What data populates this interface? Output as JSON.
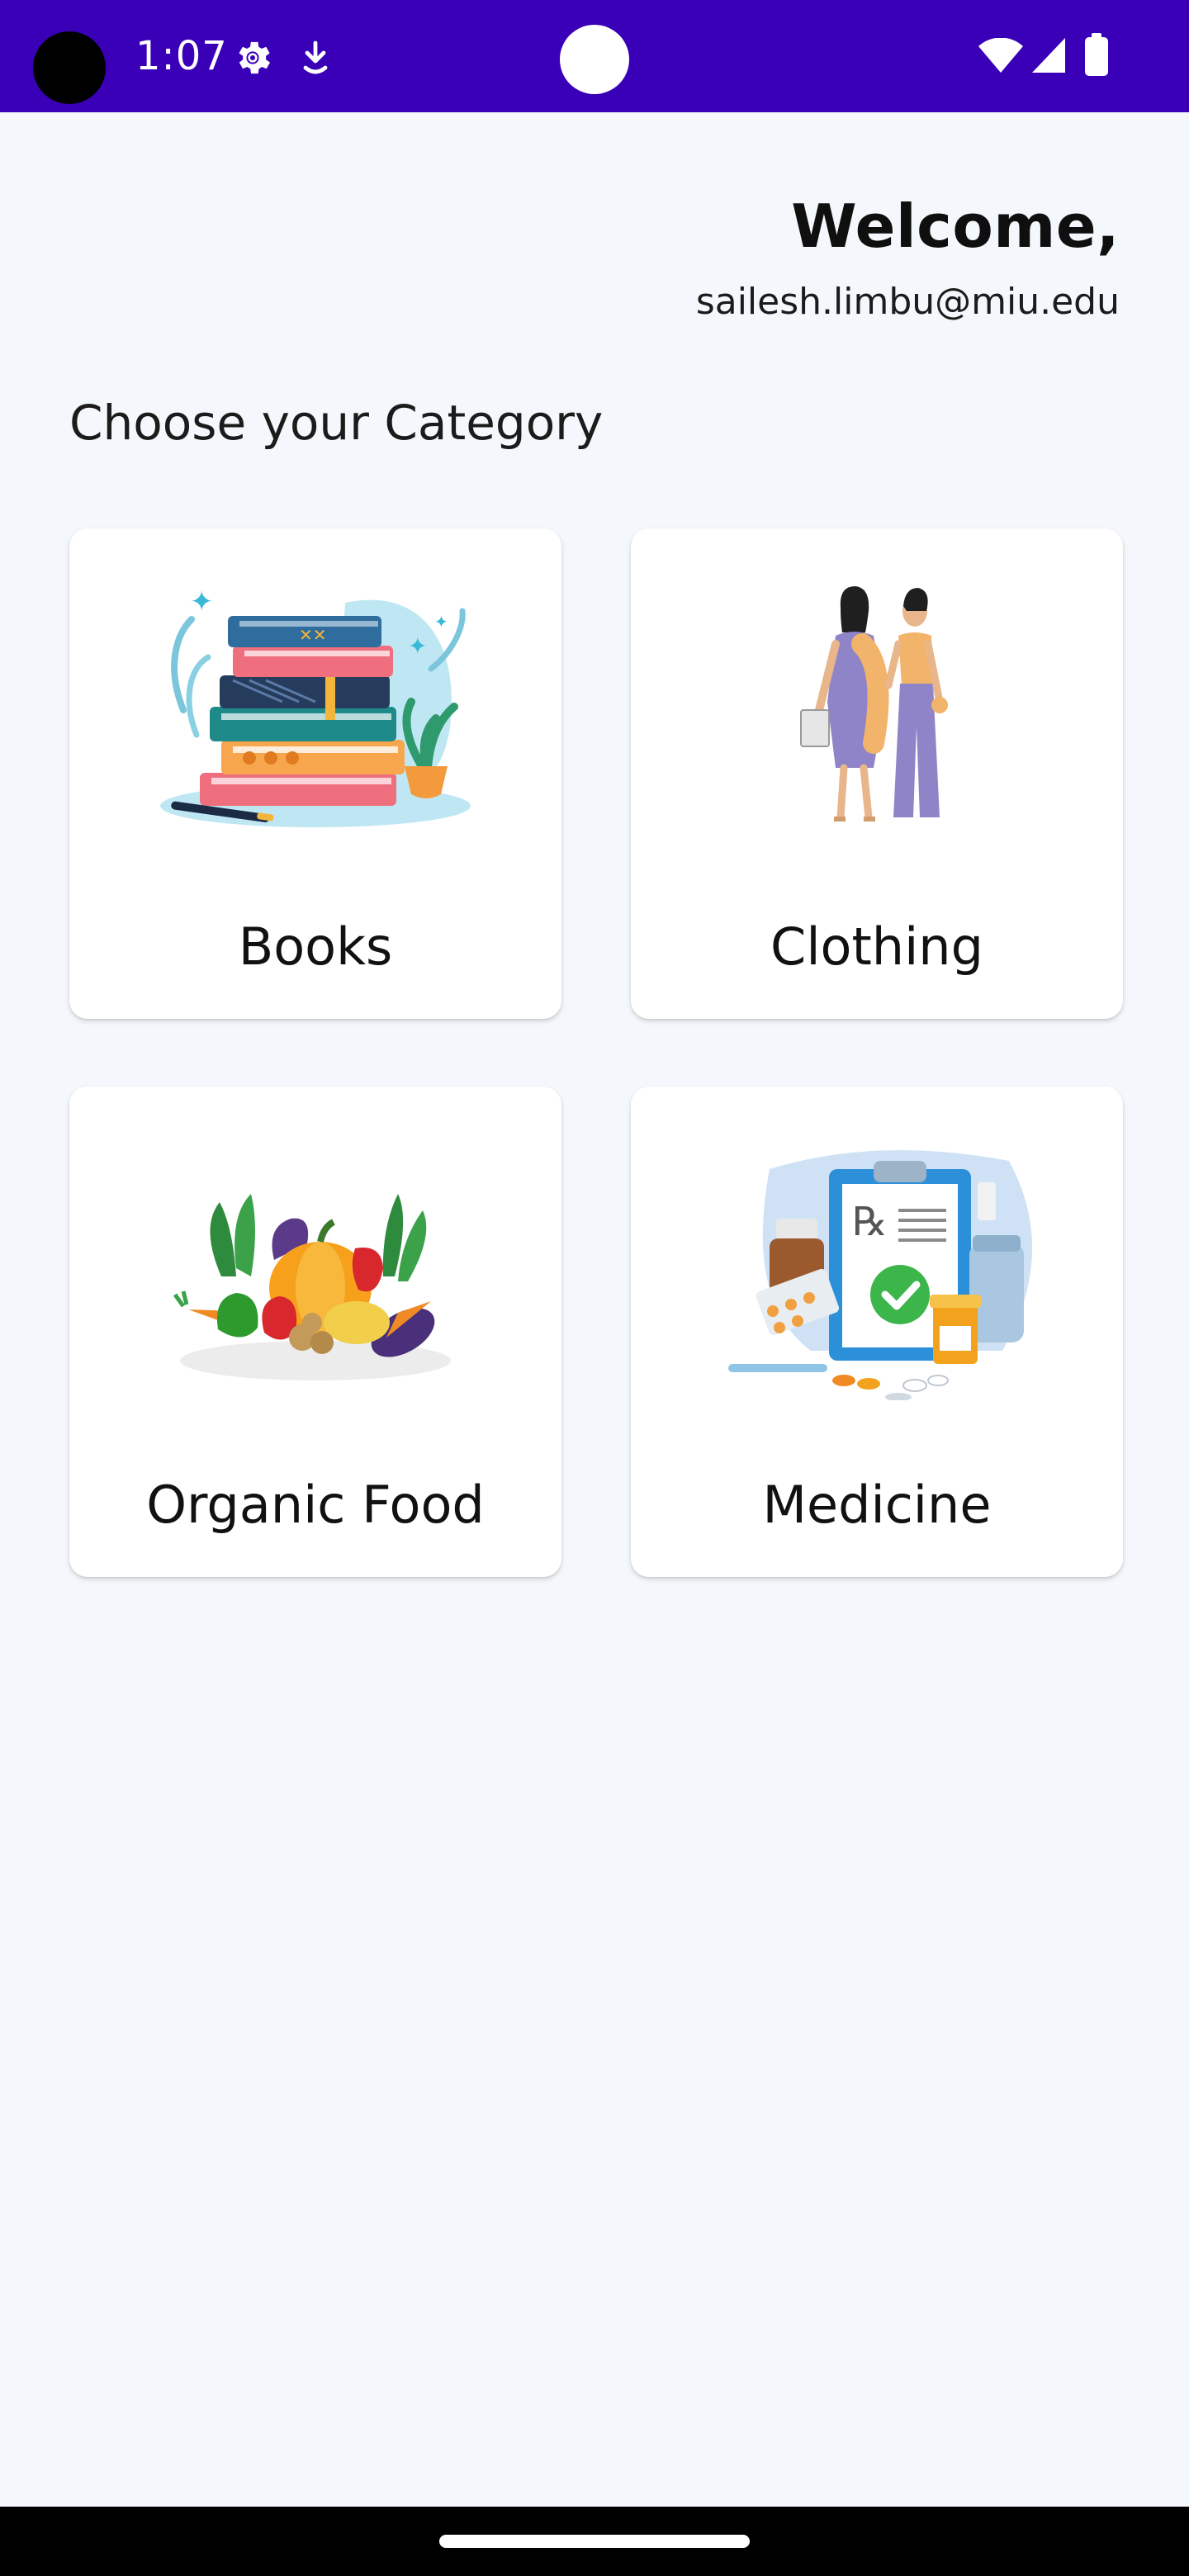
{
  "status_bar": {
    "time": "1:07",
    "icons": [
      "settings-gear-icon",
      "download-arrow-icon",
      "wifi-icon",
      "cellular-signal-icon",
      "battery-icon"
    ],
    "background": "#3a00b7"
  },
  "header": {
    "welcome": "Welcome,",
    "email": "sailesh.limbu@miu.edu"
  },
  "section_title": "Choose your Category",
  "categories": [
    {
      "label": "Books",
      "icon": "books-stack-illustration"
    },
    {
      "label": "Clothing",
      "icon": "fashion-models-illustration"
    },
    {
      "label": "Organic Food",
      "icon": "vegetables-illustration"
    },
    {
      "label": "Medicine",
      "icon": "prescription-medicine-illustration"
    }
  ],
  "colors": {
    "page_background": "#f4f7fb",
    "card_background": "#ffffff",
    "text": "#0f0f0f"
  }
}
